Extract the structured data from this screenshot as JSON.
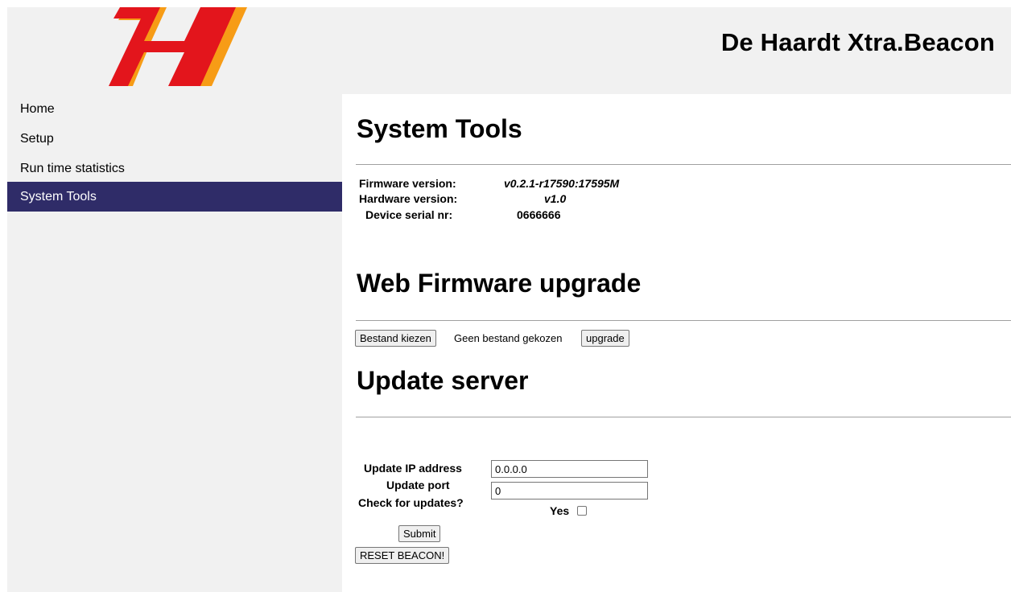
{
  "header": {
    "site_title": "De Haardt Xtra.Beacon",
    "logo_colors": {
      "primary": "#e3151c",
      "accent": "#f79c16"
    }
  },
  "sidebar": {
    "items": [
      {
        "label": "Home"
      },
      {
        "label": "Setup"
      },
      {
        "label": "Run time statistics"
      },
      {
        "label": "System Tools",
        "active": true
      }
    ],
    "active_color": "#2f2c68"
  },
  "system_tools": {
    "title": "System Tools",
    "firmware_label": "Firmware version:",
    "firmware_value": "v0.2.1-r17590:17595M",
    "hardware_label": "Hardware version:",
    "hardware_value": "v1.0",
    "serial_label": "Device serial nr:",
    "serial_value": "0666666"
  },
  "firmware_upgrade": {
    "title": "Web Firmware upgrade",
    "choose_file_label": "Bestand kiezen",
    "file_status": "Geen bestand gekozen",
    "upgrade_label": "upgrade"
  },
  "update_server": {
    "title": "Update server",
    "ip_label": "Update IP address",
    "ip_value": "0.0.0.0",
    "port_label": "Update port",
    "port_value": "0",
    "check_label": "Check for updates?",
    "yes_label": "Yes",
    "check_value": false,
    "submit_label": "Submit",
    "reset_label": "RESET BEACON!"
  }
}
